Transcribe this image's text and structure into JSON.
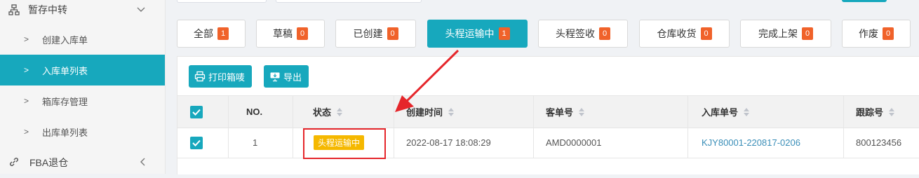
{
  "sidebar": {
    "group_label": "暂存中转",
    "items": [
      {
        "label": "创建入库单",
        "active": false
      },
      {
        "label": "入库单列表",
        "active": true
      },
      {
        "label": "箱库存管理",
        "active": false
      },
      {
        "label": "出库单列表",
        "active": false
      }
    ],
    "fba_label": "FBA退仓"
  },
  "tabs": [
    {
      "label": "全部",
      "count": "1"
    },
    {
      "label": "草稿",
      "count": "0"
    },
    {
      "label": "已创建",
      "count": "0"
    },
    {
      "label": "头程运输中",
      "count": "1"
    },
    {
      "label": "头程签收",
      "count": "0"
    },
    {
      "label": "仓库收货",
      "count": "0"
    },
    {
      "label": "完成上架",
      "count": "0"
    },
    {
      "label": "作废",
      "count": "0"
    }
  ],
  "actions": {
    "print_label": "打印箱唛",
    "export_label": "导出"
  },
  "table": {
    "headers": [
      "NO.",
      "状态",
      "创建时间",
      "客单号",
      "入库单号",
      "跟踪号"
    ],
    "rows": [
      {
        "no": "1",
        "status": "头程运输中",
        "created": "2022-08-17 18:08:29",
        "customer_no": "AMD0000001",
        "inbound_no": "KJY80001-220817-0206",
        "tracking_no": "800123456"
      }
    ]
  },
  "colors": {
    "accent": "#17a8bd",
    "badge": "#f0622a",
    "status": "#f5b800",
    "annotation": "#e5262b"
  }
}
